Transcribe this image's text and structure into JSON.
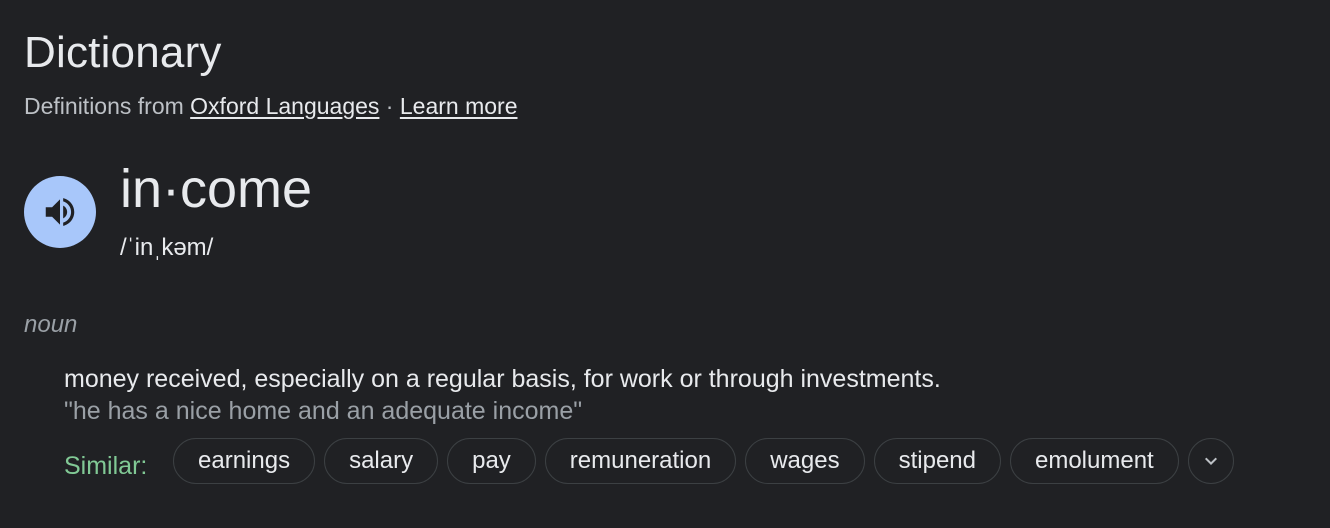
{
  "header": {
    "title": "Dictionary",
    "source_prefix": "Definitions from",
    "source_link": "Oxford Languages",
    "separator": " · ",
    "learn_more": "Learn more"
  },
  "entry": {
    "word": "in·come",
    "phonetic": "/ˈinˌkəm/",
    "audio_icon": "speaker-icon",
    "part_of_speech": "noun",
    "definition": "money received, especially on a regular basis, for work or through investments.",
    "example": "\"he has a nice home and an adequate income\""
  },
  "similar": {
    "label": "Similar:",
    "words": [
      "earnings",
      "salary",
      "pay",
      "remuneration",
      "wages",
      "stipend",
      "emolument"
    ],
    "expand_icon": "chevron-down-icon"
  },
  "colors": {
    "background": "#202124",
    "audio_button": "#a8c7fa",
    "similar_label": "#81c995",
    "muted_text": "#9aa0a6"
  }
}
